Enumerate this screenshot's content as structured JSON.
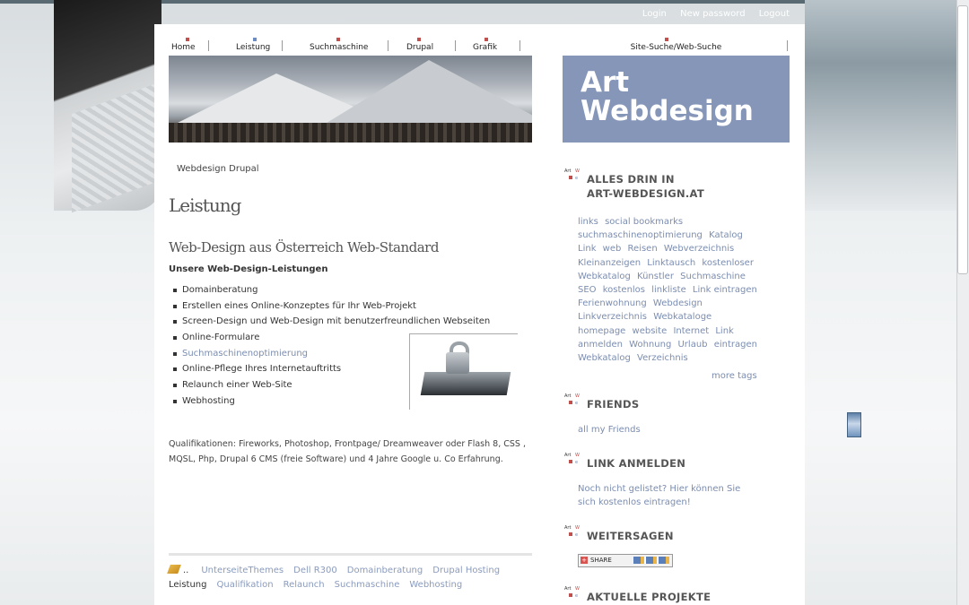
{
  "user_links": [
    "Login",
    "New password",
    "Logout"
  ],
  "nav": [
    {
      "label": "Home",
      "mark": "red"
    },
    {
      "label": "Leistung",
      "mark": "blue"
    },
    {
      "label": "Suchmaschine",
      "mark": "red"
    },
    {
      "label": "Drupal",
      "mark": "red"
    },
    {
      "label": "Grafik",
      "mark": "red"
    }
  ],
  "site_search": "Site-Suche/Web-Suche",
  "brand": {
    "line1": "Art",
    "line2": "Webdesign"
  },
  "breadcrumb": "Webdesign Drupal",
  "page_title": "Leistung",
  "section_heading": "Web-Design aus Österreich Web-Standard",
  "subheading": "Unsere Web-Design-Leistungen",
  "services": [
    "Domainberatung",
    "Erstellen eines Online-Konzeptes für Ihr Web-Projekt",
    "Screen-Design und Web-Design mit benutzerfreundlichen Webseiten",
    "Online-Formulare",
    "Suchmaschinenoptimierung",
    "Online-Pflege Ihres Internetauftritts",
    "Relaunch einer Web-Site",
    "Webhosting"
  ],
  "qualifications": "Qualifikationen: Fireworks, Photoshop, Frontpage/ Dreamweaver oder Flash 8, CSS , MQSL, Php, Drupal 6 CMS (freie Software) und 4 Jahre Google u. Co Erfahrung.",
  "footer": {
    "dots": "..",
    "row1": [
      "UnterseiteThemes",
      "Dell R300",
      "Domainberatung",
      "Drupal Hosting"
    ],
    "current": "Leistung",
    "row2": [
      "Qualifikation",
      "Relaunch",
      "Suchmaschine",
      "Webhosting"
    ]
  },
  "sidebar": {
    "block_logo": {
      "art": "Art",
      "w": "W",
      "e": "e"
    },
    "tags_title_1": "ALLES DRIN IN",
    "tags_title_2": "ART-WEBDESIGN.AT",
    "tags": [
      "links",
      "social bookmarks",
      "suchmaschinenoptimierung",
      "Katalog",
      "Link",
      "web",
      "Reisen",
      "Webverzeichnis",
      "Kleinanzeigen",
      "Linktausch",
      "kostenloser",
      "Webkatalog",
      "Künstler",
      "Suchmaschine",
      "SEO",
      "kostenlos",
      "linkliste",
      "Link eintragen",
      "Ferienwohnung",
      "Webdesign",
      "Linkverzeichnis",
      "Webkataloge",
      "homepage",
      "website",
      "Internet",
      "Link anmelden",
      "Wohnung",
      "Urlaub",
      "eintragen",
      "Webkatalog",
      "Verzeichnis"
    ],
    "more_tags": "more tags",
    "friends_title": "FRIENDS",
    "friends_link": "all my Friends",
    "link_title": "LINK ANMELDEN",
    "link_line1": "Noch nicht gelistet? Hier können Sie",
    "link_line2": "sich kostenlos eintragen!",
    "share_title": "WEITERSAGEN",
    "share_button": "SHARE",
    "projects_title": "AKTUELLE PROJEKTE"
  }
}
